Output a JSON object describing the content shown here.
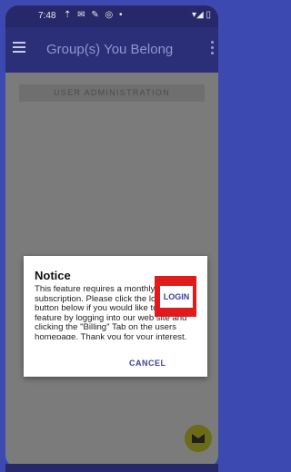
{
  "status_bar": {
    "time": "7:48",
    "icons_text": "⇡ ✉ ✎ ◎ •",
    "right_icons": "▾◢ ▯"
  },
  "toolbar": {
    "title": "Group(s) You Belong"
  },
  "content": {
    "admin_label": "USER ADMINISTRATION"
  },
  "dialog": {
    "title": "Notice",
    "message": "This feature requires a monthly\nsubscription. Please click the login\nbutton below if you would like to add this\nfeature by logging into our web site and\nclicking the \"Billing\" Tab on the users\nhomepage. Thank you for your interest.",
    "cancel_label": "CANCEL",
    "login_label": "LOGIN"
  },
  "colors": {
    "accent": "#3a3fa8",
    "highlight": "#e11b1b",
    "toolbar": "#2b2f78"
  },
  "icons": [
    "menu-icon",
    "more-vert-icon",
    "mail-icon"
  ]
}
